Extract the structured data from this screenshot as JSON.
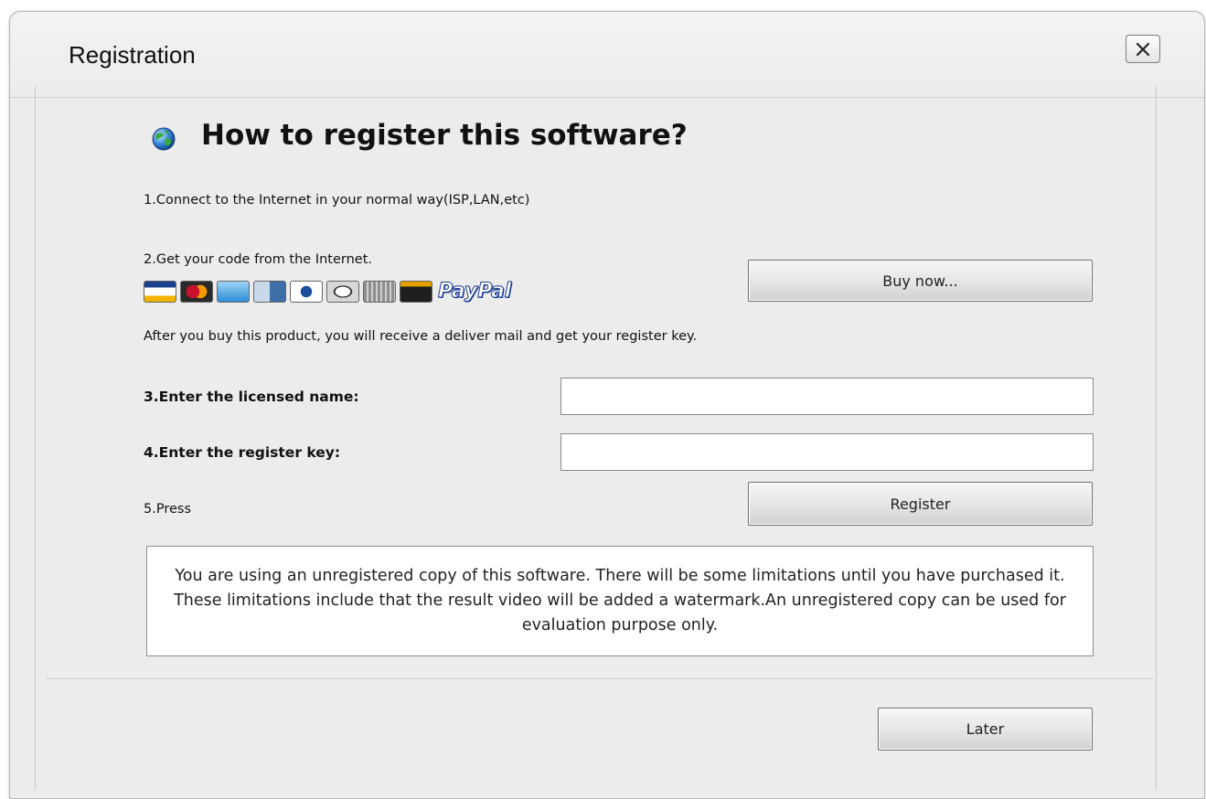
{
  "window": {
    "title": "Registration"
  },
  "heading": "How to register this software?",
  "steps": {
    "step1": "1.Connect to the Internet in your normal way(ISP,LAN,etc)",
    "step2": "2.Get your code from the Internet.",
    "after_buy": "After you buy this product, you will receive a deliver mail and get your register key.",
    "step3": "3.Enter the licensed name:",
    "step4": "4.Enter the register key:",
    "step5": "5.Press"
  },
  "payment": {
    "paypal_label": "PayPal",
    "cards": [
      {
        "name": "visa-card-icon",
        "color": "#1a3f8f",
        "accent": "#f2b400"
      },
      {
        "name": "mastercard-icon",
        "color": "#c8102e",
        "accent": "#f59a00"
      },
      {
        "name": "amex-card-icon",
        "color": "#2a8fd6",
        "accent": "#9fd4f5"
      },
      {
        "name": "bank-card-icon",
        "color": "#3d6fa8",
        "accent": "#c9d9e9"
      },
      {
        "name": "diners-card-icon",
        "color": "#ffffff",
        "accent": "#1b4f9c"
      },
      {
        "name": "discover-card-icon",
        "color": "#d7d7d7",
        "accent": "#333333"
      },
      {
        "name": "wire-transfer-icon",
        "color": "#8f8f8f",
        "accent": "#cfcfcf"
      },
      {
        "name": "jcb-card-icon",
        "color": "#1e1e1e",
        "accent": "#e0a000"
      }
    ]
  },
  "buttons": {
    "buy_now": "Buy now...",
    "register": "Register",
    "later": "Later"
  },
  "fields": {
    "licensed_name": {
      "value": "",
      "placeholder": ""
    },
    "register_key": {
      "value": "",
      "placeholder": ""
    }
  },
  "notice": "You are using an unregistered copy of this software. There will be some limitations until you have purchased it. These limitations include that the result video will be added a watermark.An unregistered copy can be used for evaluation purpose only."
}
